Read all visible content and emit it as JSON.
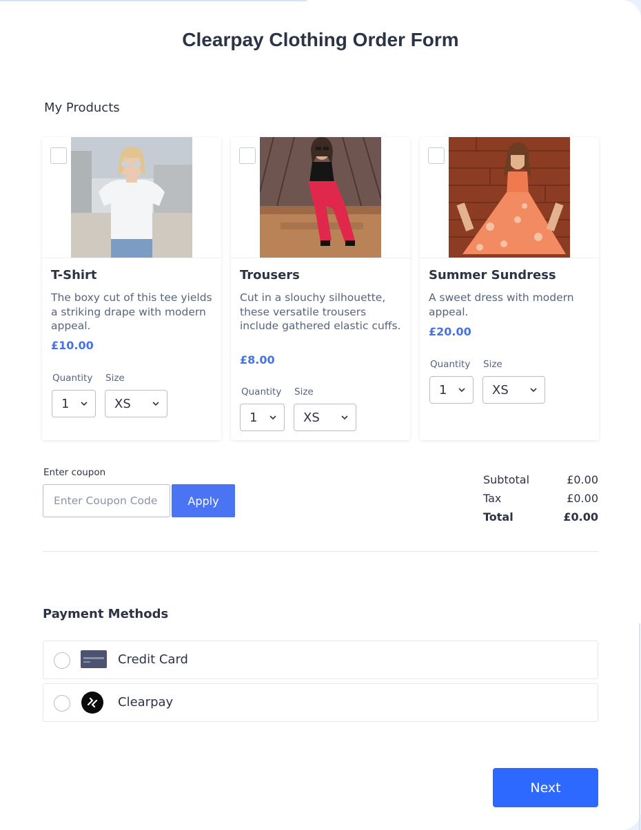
{
  "form": {
    "title": "Clearpay Clothing Order Form",
    "products_label": "My Products"
  },
  "products": [
    {
      "name": "T-Shirt",
      "description": "The boxy cut of this tee yields a striking drape with modern appeal.",
      "price": "£10.00",
      "quantity_label": "Quantity",
      "quantity": "1",
      "size_label": "Size",
      "size": "XS"
    },
    {
      "name": "Trousers",
      "description": "Cut in a slouchy silhouette, these versatile trousers include gathered elastic cuffs.",
      "price": "£8.00",
      "quantity_label": "Quantity",
      "quantity": "1",
      "size_label": "Size",
      "size": "XS"
    },
    {
      "name": "Summer Sundress",
      "description": "A sweet dress with modern appeal.",
      "price": "£20.00",
      "quantity_label": "Quantity",
      "quantity": "1",
      "size_label": "Size",
      "size": "XS"
    }
  ],
  "coupon": {
    "label": "Enter coupon",
    "placeholder": "Enter Coupon Code",
    "apply_label": "Apply"
  },
  "totals": {
    "subtotal_label": "Subtotal",
    "subtotal": "£0.00",
    "tax_label": "Tax",
    "tax": "£0.00",
    "total_label": "Total",
    "total": "£0.00"
  },
  "payment": {
    "title": "Payment Methods",
    "methods": [
      {
        "label": "Credit Card",
        "icon": "credit-card-icon"
      },
      {
        "label": "Clearpay",
        "icon": "clearpay-logo-icon"
      }
    ]
  },
  "next_label": "Next",
  "colors": {
    "accent": "#4573e4",
    "apply_button": "#4b74f5",
    "next_button": "#2e69ff",
    "text": "#2c3345"
  }
}
